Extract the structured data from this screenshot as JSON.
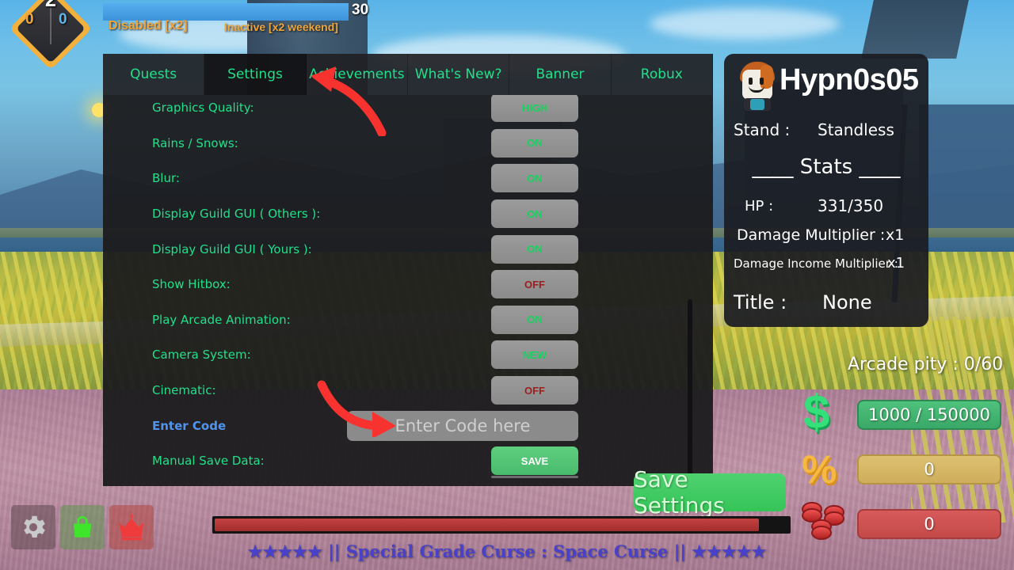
{
  "hud": {
    "level_diamond": {
      "top_value": "2",
      "left_value": "0",
      "right_value": "0"
    },
    "xp_value": "30",
    "buffs": [
      {
        "label": "Disabled [x2]"
      },
      {
        "label": "Inactive [x2 weekend]"
      }
    ]
  },
  "settings_window": {
    "tabs": [
      {
        "label": "Quests",
        "active": false
      },
      {
        "label": "Settings",
        "active": true
      },
      {
        "label": "Achievements",
        "active": false
      },
      {
        "label": "What's New?",
        "active": false
      },
      {
        "label": "Banner",
        "active": false
      },
      {
        "label": "Robux",
        "active": false
      }
    ],
    "rows": [
      {
        "label": "Graphics Quality:",
        "value": "HIGH",
        "state": "neutral"
      },
      {
        "label": "Rains / Snows:",
        "value": "ON",
        "state": "on"
      },
      {
        "label": "Blur:",
        "value": "ON",
        "state": "on"
      },
      {
        "label": "Display Guild GUI ( Others ):",
        "value": "ON",
        "state": "on"
      },
      {
        "label": "Display Guild GUI ( Yours ):",
        "value": "ON",
        "state": "on"
      },
      {
        "label": "Show Hitbox:",
        "value": "OFF",
        "state": "off"
      },
      {
        "label": "Play Arcade Animation:",
        "value": "ON",
        "state": "on"
      },
      {
        "label": "Camera System:",
        "value": "NEW",
        "state": "neutral"
      },
      {
        "label": "Cinematic:",
        "value": "OFF",
        "state": "off"
      }
    ],
    "code_row": {
      "label": "Enter Code",
      "placeholder": "Enter Code here",
      "value": ""
    },
    "save_row": {
      "label": "Manual Save Data:",
      "button_label": "SAVE"
    },
    "save_settings_label": "Save Settings"
  },
  "player": {
    "name": "Hypn0s05",
    "stand_key": "Stand :",
    "stand_value": "Standless",
    "stats_header": "____ Stats ____",
    "hp_key": "HP :",
    "hp_value": "331/350",
    "damage_multiplier_key": "Damage Multiplier :",
    "damage_multiplier_value": "x1",
    "damage_income_key": "Damage Income Multiplier :",
    "damage_income_value": "x1",
    "title_key": "Title :",
    "title_value": "None"
  },
  "economy": {
    "arcade_pity": "Arcade pity : 0/60",
    "cash": "1000 / 150000",
    "shards": "0",
    "coins": "0"
  },
  "bottom": {
    "curse_text": "★★★★★ || Special Grade Curse : Space Curse || ★★★★★"
  },
  "colors": {
    "tab_text": "#21e08a",
    "toggle_on": "#15d45e",
    "toggle_off": "#9e1d1d",
    "code_label": "#4f95f0",
    "save_green": "#49bb6c",
    "arrow_red": "#f8322e",
    "cash_green": "#3aa868",
    "shard_gold": "#cfae5c",
    "coin_red": "#c44a4a",
    "curse_purple": "#4a41c9"
  }
}
